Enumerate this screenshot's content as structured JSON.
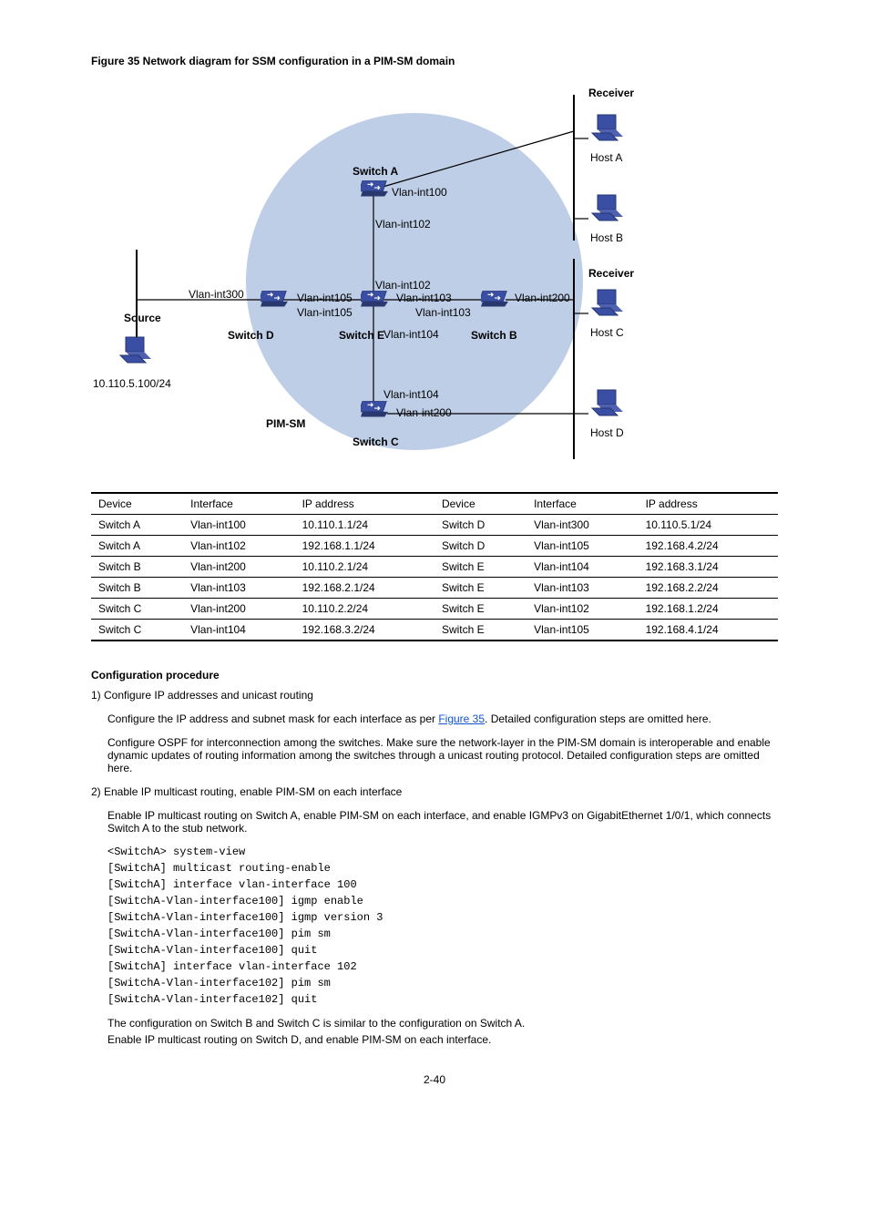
{
  "figureTitle": "Figure 35 Network diagram for SSM configuration in a PIM-SM domain",
  "labels": {
    "receiver1": "Receiver",
    "receiver2": "Receiver",
    "hostA": "Host A",
    "hostB": "Host B",
    "hostC": "Host C",
    "hostD": "Host D",
    "switchA": "Switch A",
    "switchB": "Switch B",
    "switchC": "Switch C",
    "switchD": "Switch D",
    "switchE": "Switch E",
    "source": "Source",
    "srcIp": "10.110.5.100/24",
    "vl100a": "Vlan-int100",
    "vl102a": "Vlan-int102",
    "vl102e": "Vlan-int102",
    "vl103e": "Vlan-int103",
    "vl103b": "Vlan-int103",
    "vl104e": "Vlan-int104",
    "vl104c": "Vlan-int104",
    "vl105d": "Vlan-int105",
    "vl105e": "Vlan-int105",
    "vl200b": "Vlan-int200",
    "vl200c": "Vlan-int200",
    "vl300d": "Vlan-int300",
    "pimsm": "PIM-SM"
  },
  "tableHeaders": [
    "Device",
    "Interface",
    "IP address",
    "Device",
    "Interface",
    "IP address"
  ],
  "tableRows": [
    [
      "Switch A",
      "Vlan-int100",
      "10.110.1.1/24",
      "Switch D",
      "Vlan-int300",
      "10.110.5.1/24"
    ],
    [
      "Switch A",
      "Vlan-int102",
      "192.168.1.1/24",
      "Switch D",
      "Vlan-int105",
      "192.168.4.2/24"
    ],
    [
      "Switch B",
      "Vlan-int200",
      "10.110.2.1/24",
      "Switch E",
      "Vlan-int104",
      "192.168.3.1/24"
    ],
    [
      "Switch B",
      "Vlan-int103",
      "192.168.2.1/24",
      "Switch E",
      "Vlan-int103",
      "192.168.2.2/24"
    ],
    [
      "Switch C",
      "Vlan-int200",
      "10.110.2.2/24",
      "Switch E",
      "Vlan-int102",
      "192.168.1.2/24"
    ],
    [
      "Switch C",
      "Vlan-int104",
      "192.168.3.2/24",
      "Switch E",
      "Vlan-int105",
      "192.168.4.1/24"
    ]
  ],
  "content": {
    "procTitle": "Configuration procedure",
    "step1": "1)    Configure IP addresses and unicast routing",
    "step1p1": "Configure the IP address and subnet mask for each interface as per Figure 35. Detailed configuration steps are omitted here.",
    "step1p2": "Configure OSPF for interconnection among the switches. Make sure the network-layer in the PIM-SM domain is interoperable and enable dynamic updates of routing information among the switches through a unicast routing protocol. Detailed configuration steps are omitted here.",
    "step2": "2)    Enable IP multicast routing, enable PIM-SM on each interface",
    "step2p": "Enable IP multicast routing on Switch A, enable PIM-SM on each interface, and enable IGMPv3 on GigabitEthernet 1/0/1, which connects Switch A to the stub network.",
    "cmd1": "<SwitchA> system-view",
    "cmd2": "[SwitchA] multicast routing-enable",
    "cmd3": "[SwitchA] interface vlan-interface 100",
    "cmd4": "[SwitchA-Vlan-interface100] igmp enable",
    "cmd5": "[SwitchA-Vlan-interface100] igmp version 3",
    "cmd6": "[SwitchA-Vlan-interface100] pim sm",
    "cmd7": "[SwitchA-Vlan-interface100] quit",
    "cmd8": "[SwitchA] interface vlan-interface 102",
    "cmd9": "[SwitchA-Vlan-interface102] pim sm",
    "cmd10": "[SwitchA-Vlan-interface102] quit",
    "note1": "The configuration on Switch B and Switch C is similar to the configuration on Switch A.",
    "note2": "Enable IP multicast routing on Switch D, and enable PIM-SM on each interface.",
    "page": "2-40"
  }
}
